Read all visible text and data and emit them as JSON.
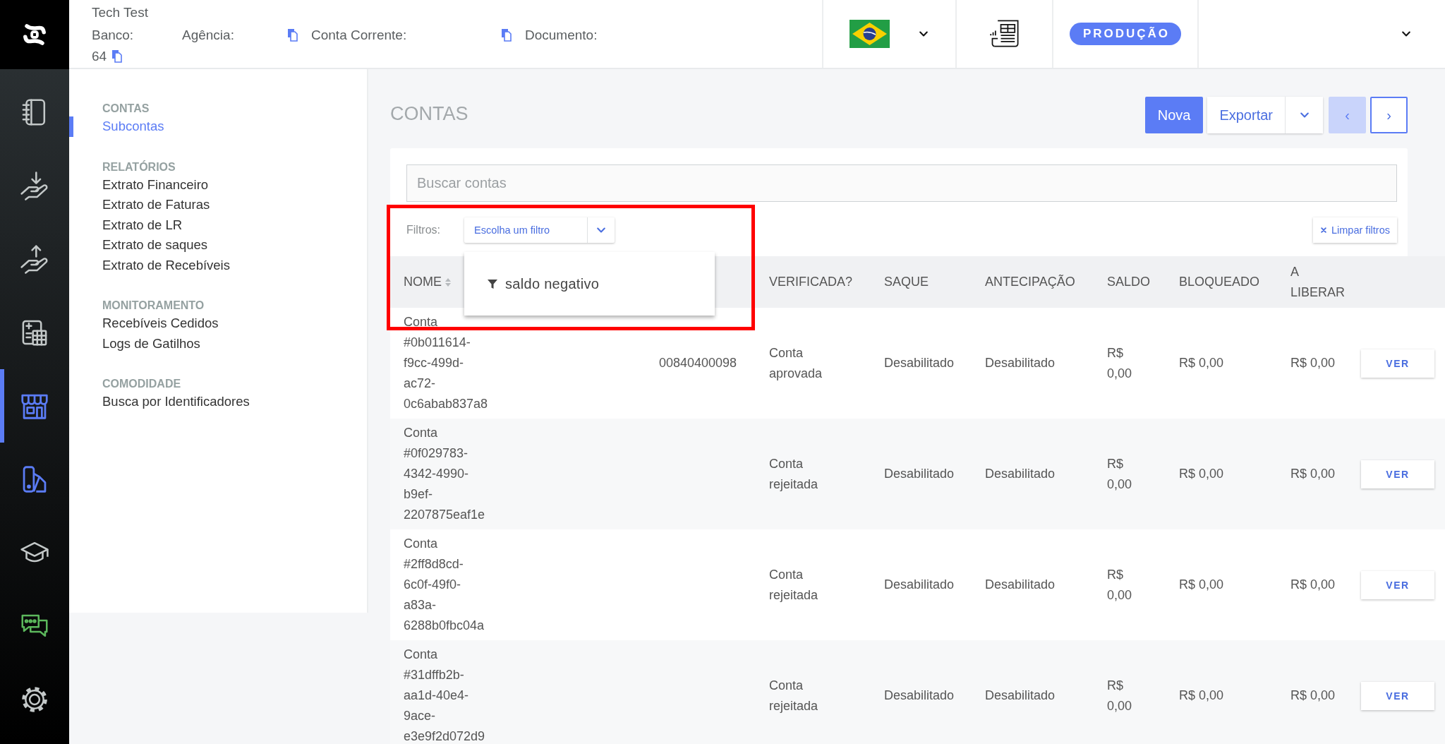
{
  "rail": {
    "items": [
      {
        "kind": "notebook",
        "selected": false,
        "color": "#c3c8c8"
      },
      {
        "kind": "hand-down",
        "selected": false,
        "color": "#c3c8c8"
      },
      {
        "kind": "hand-up",
        "selected": false,
        "color": "#c3c8c8"
      },
      {
        "kind": "calculator",
        "selected": false,
        "color": "#c3c8c8"
      },
      {
        "kind": "store",
        "selected": true,
        "color": "#5b7cf5"
      },
      {
        "kind": "swatch",
        "selected": false,
        "color": "#5b7cf5"
      },
      {
        "kind": "cap",
        "selected": false,
        "color": "#c3c8c8"
      },
      {
        "kind": "chat",
        "selected": false,
        "color": "#5cb85c"
      },
      {
        "kind": "gear",
        "selected": false,
        "color": "#c3c8c8"
      }
    ]
  },
  "top_bar": {
    "company": "Tech Test",
    "fields": [
      {
        "label": "Banco:",
        "value": "64",
        "copy": true
      },
      {
        "label": "Agência:",
        "copy": true
      },
      {
        "label": "Conta Corrente:",
        "copy": true
      },
      {
        "label": "Documento:",
        "copy": false
      }
    ],
    "environment": "PRODUÇÃO"
  },
  "submenu": {
    "sections": [
      {
        "title": "CONTAS",
        "items": [
          {
            "label": "Subcontas",
            "selected": true
          }
        ]
      },
      {
        "title": "RELATÓRIOS",
        "items": [
          {
            "label": "Extrato Financeiro",
            "selected": false
          },
          {
            "label": "Extrato de Faturas",
            "selected": false
          },
          {
            "label": "Extrato de LR",
            "selected": false
          },
          {
            "label": "Extrato de saques",
            "selected": false
          },
          {
            "label": "Extrato de Recebíveis",
            "selected": false
          }
        ]
      },
      {
        "title": "MONITORAMENTO",
        "items": [
          {
            "label": "Recebíveis Cedidos",
            "selected": false
          },
          {
            "label": "Logs de Gatilhos",
            "selected": false
          }
        ]
      },
      {
        "title": "COMODIDADE",
        "items": [
          {
            "label": "Busca por Identificadores",
            "selected": false
          }
        ]
      }
    ]
  },
  "page": {
    "title": "CONTAS",
    "new_button": "Nova",
    "export_button": "Exportar",
    "pager": {
      "previous": {
        "label": "‹",
        "disabled": true
      },
      "next": {
        "label": "›",
        "disabled": false
      }
    }
  },
  "search": {
    "placeholder": "Buscar contas"
  },
  "filters": {
    "label": "Filtros:",
    "select": {
      "value": "Escolha um filtro",
      "expanded": true
    },
    "options": [
      {
        "label": "saldo negativo"
      }
    ],
    "clear_button": "Limpar filtros"
  },
  "highlight": {
    "kind": "rectangle"
  },
  "table": {
    "columns": [
      {
        "label": "NOME",
        "sortable": true
      },
      {
        "label": "VERIFICADA?",
        "sortable": false
      },
      {
        "label": "SAQUE",
        "sortable": false
      },
      {
        "label": "ANTECIPAÇÃO",
        "sortable": false
      },
      {
        "label": "SALDO",
        "sortable": false
      },
      {
        "label": "BLOQUEADO",
        "sortable": false
      },
      {
        "label": "A LIBERAR",
        "sortable": false
      }
    ],
    "rows": [
      {
        "name": "Conta #0b011614-f9cc-499d-ac72-0c6abab837a8",
        "document": "00840400098",
        "verification": "Conta aprovada",
        "withdrawal": "Desabilitado",
        "anticipation": "Desabilitado",
        "balance": "R$ 0,00",
        "blocked": "R$ 0,00",
        "to_release": "R$ 0,00",
        "action": "VER"
      },
      {
        "name": "Conta #0f029783-4342-4990-b9ef-2207875eaf1e",
        "verification": "Conta rejeitada",
        "withdrawal": "Desabilitado",
        "anticipation": "Desabilitado",
        "balance": "R$ 0,00",
        "blocked": "R$ 0,00",
        "to_release": "R$ 0,00",
        "action": "VER"
      },
      {
        "name": "Conta #2ff8d8cd-6c0f-49f0-a83a-6288b0fbc04a",
        "verification": "Conta rejeitada",
        "withdrawal": "Desabilitado",
        "anticipation": "Desabilitado",
        "balance": "R$ 0,00",
        "blocked": "R$ 0,00",
        "to_release": "R$ 0,00",
        "action": "VER"
      },
      {
        "name": "Conta #31dffb2b-aa1d-40e4-9ace-e3e9f2d072d9",
        "verification": "Conta rejeitada",
        "withdrawal": "Desabilitado",
        "anticipation": "Desabilitado",
        "balance": "R$ 0,00",
        "blocked": "R$ 0,00",
        "to_release": "R$ 0,00",
        "action": "VER"
      }
    ]
  }
}
